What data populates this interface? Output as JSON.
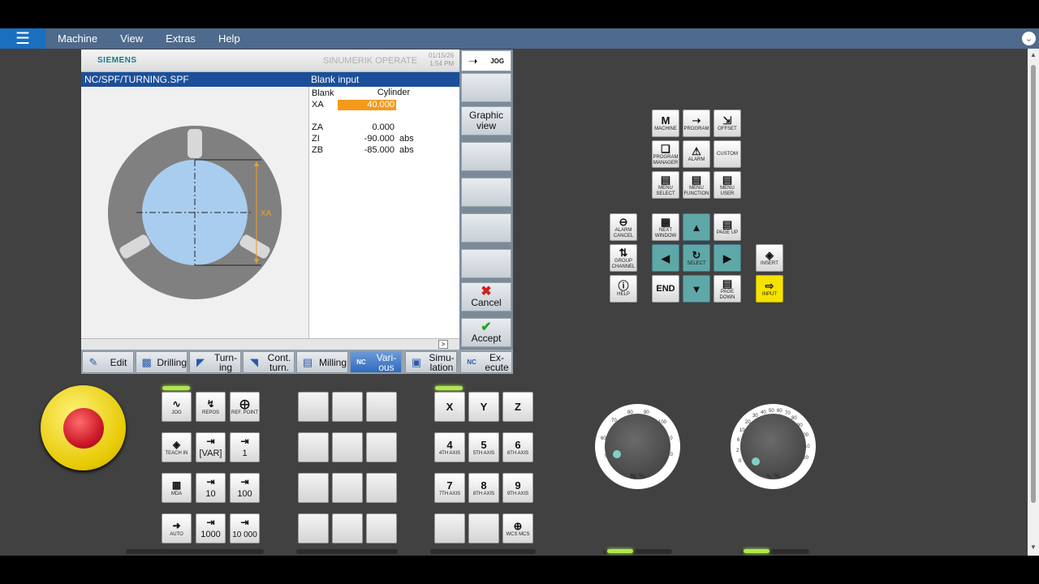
{
  "menu": {
    "items": [
      "Machine",
      "View",
      "Extras",
      "Help"
    ]
  },
  "hmi": {
    "brand": "SIEMENS",
    "product": "SINUMERIK OPERATE",
    "date": "01/15/26",
    "time": "1:54 PM",
    "path": "NC/SPF/TURNING.SPF",
    "panel_title": "Blank input",
    "form": {
      "blank_label": "Blank",
      "blank_value": "Cylinder",
      "rows": [
        {
          "label": "XA",
          "value": "40.000",
          "unit": ""
        },
        {
          "label": "ZA",
          "value": "0.000",
          "unit": ""
        },
        {
          "label": "ZI",
          "value": "-90.000",
          "unit": "abs"
        },
        {
          "label": "ZB",
          "value": "-85.000",
          "unit": "abs"
        }
      ]
    },
    "graphic": {
      "dim_label": "XA"
    },
    "vertical_softkeys": {
      "top_label": "JOG",
      "graphic_view": "Graphic view",
      "cancel": "Cancel",
      "accept": "Accept"
    },
    "horizontal_softkeys": [
      "Edit",
      "Drilling",
      "Turn-ing",
      "Cont. turn.",
      "Milling",
      "Vari-ous",
      "Simu-lation",
      "Ex-ecute"
    ]
  },
  "panel": {
    "top_keys": [
      "MACHINE",
      "PROGRAM",
      "OFFSET",
      "PROGRAM MANAGER",
      "ALARM",
      "CUSTOM",
      "MENU SELECT",
      "MENU FUNCTION",
      "MENU USER"
    ],
    "nav_keys": [
      "ALARM CANCEL",
      "NEXT WINDOW",
      "PAGE UP",
      "GROUP CHANNEL",
      "SELECT",
      "INSERT",
      "HELP",
      "END",
      "PAGE DOWN",
      "INPUT"
    ],
    "mode_keys": [
      "JOG",
      "REPOS",
      "REF. POINT",
      "TEACH IN",
      "[VAR]",
      "1",
      "MDA",
      "10",
      "100",
      "AUTO",
      "1000",
      "10 000"
    ],
    "axis_keys": [
      {
        "main": "X",
        "sub": ""
      },
      {
        "main": "Y",
        "sub": ""
      },
      {
        "main": "Z",
        "sub": ""
      },
      {
        "main": "4",
        "sub": "4TH AXIS"
      },
      {
        "main": "5",
        "sub": "5TH AXIS"
      },
      {
        "main": "6",
        "sub": "6TH AXIS"
      },
      {
        "main": "7",
        "sub": "7TH AXIS"
      },
      {
        "main": "8",
        "sub": "8TH AXIS"
      },
      {
        "main": "9",
        "sub": "9TH AXIS"
      },
      {
        "main": "",
        "sub": ""
      },
      {
        "main": "",
        "sub": ""
      },
      {
        "main": "",
        "sub": "WCS MCS"
      }
    ],
    "end_key": "END",
    "dial1": {
      "label": "%",
      "ticks": [
        "50",
        "60",
        "70",
        "80",
        "90",
        "100",
        "110",
        "120"
      ]
    },
    "dial2": {
      "label": "%",
      "ticks": [
        "0",
        "2",
        "6",
        "10",
        "20",
        "30",
        "40",
        "50",
        "60",
        "70",
        "80",
        "90",
        "100",
        "110",
        "120"
      ]
    }
  }
}
